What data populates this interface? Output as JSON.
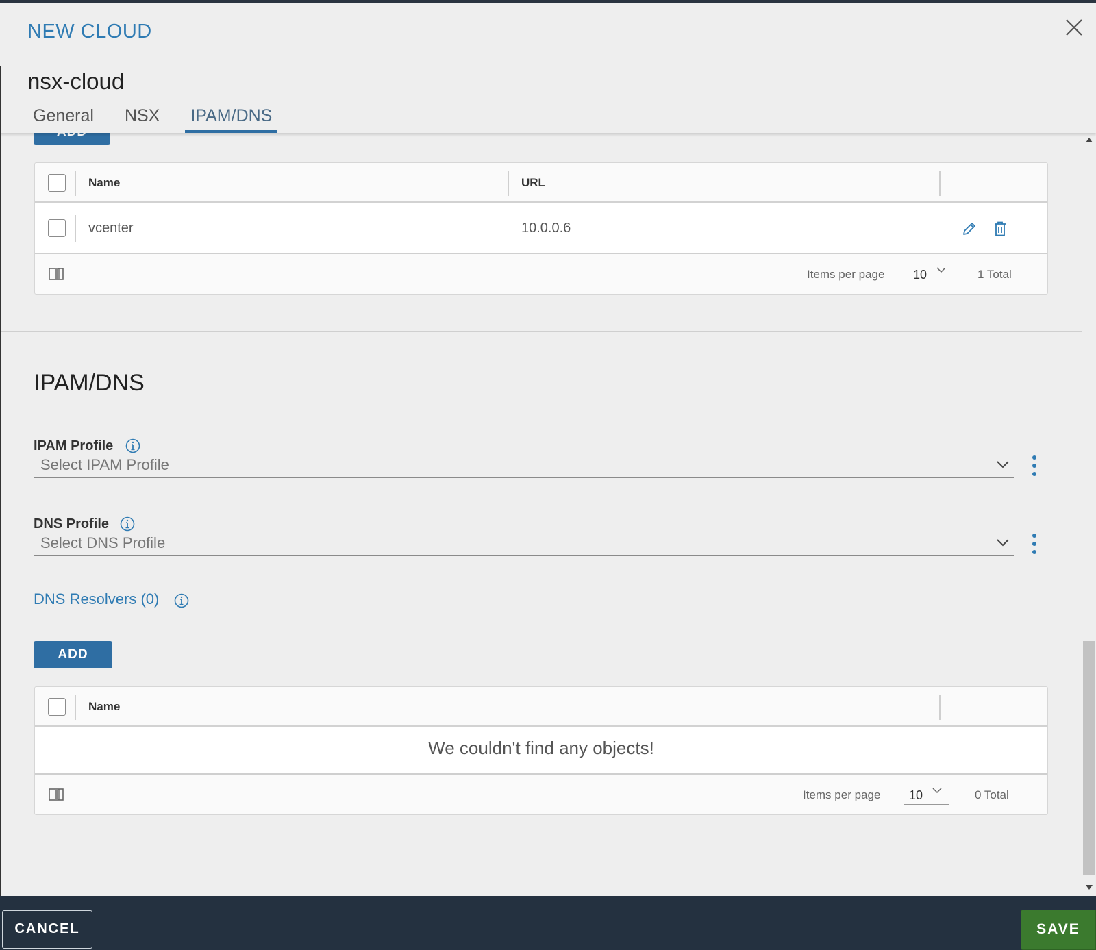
{
  "modal": {
    "title": "NEW CLOUD",
    "object_name": "nsx-cloud",
    "tabs": [
      {
        "label": "General",
        "active": false
      },
      {
        "label": "NSX",
        "active": false
      },
      {
        "label": "IPAM/DNS",
        "active": true
      }
    ]
  },
  "vcenters": {
    "add_label": "ADD",
    "columns": [
      "Name",
      "URL"
    ],
    "rows": [
      {
        "name": "vcenter",
        "url": "10.0.0.6"
      }
    ],
    "items_per_page_label": "Items per page",
    "items_per_page": "10",
    "total": "1 Total"
  },
  "ipam_dns": {
    "section_title": "IPAM/DNS",
    "ipam_profile": {
      "label": "IPAM Profile",
      "placeholder": "Select IPAM Profile"
    },
    "dns_profile": {
      "label": "DNS Profile",
      "placeholder": "Select DNS Profile"
    },
    "dns_resolvers": {
      "title": "DNS Resolvers (0)",
      "add_label": "ADD",
      "columns": [
        "Name"
      ],
      "empty_message": "We couldn't find any objects!",
      "items_per_page_label": "Items per page",
      "items_per_page": "10",
      "total": "0 Total"
    }
  },
  "footer": {
    "cancel_label": "CANCEL",
    "save_label": "SAVE"
  },
  "colors": {
    "accent": "#2f6ea3",
    "title_blue": "#2f7bb3",
    "save_green": "#3b7a2e",
    "footer_bg": "#243140"
  }
}
